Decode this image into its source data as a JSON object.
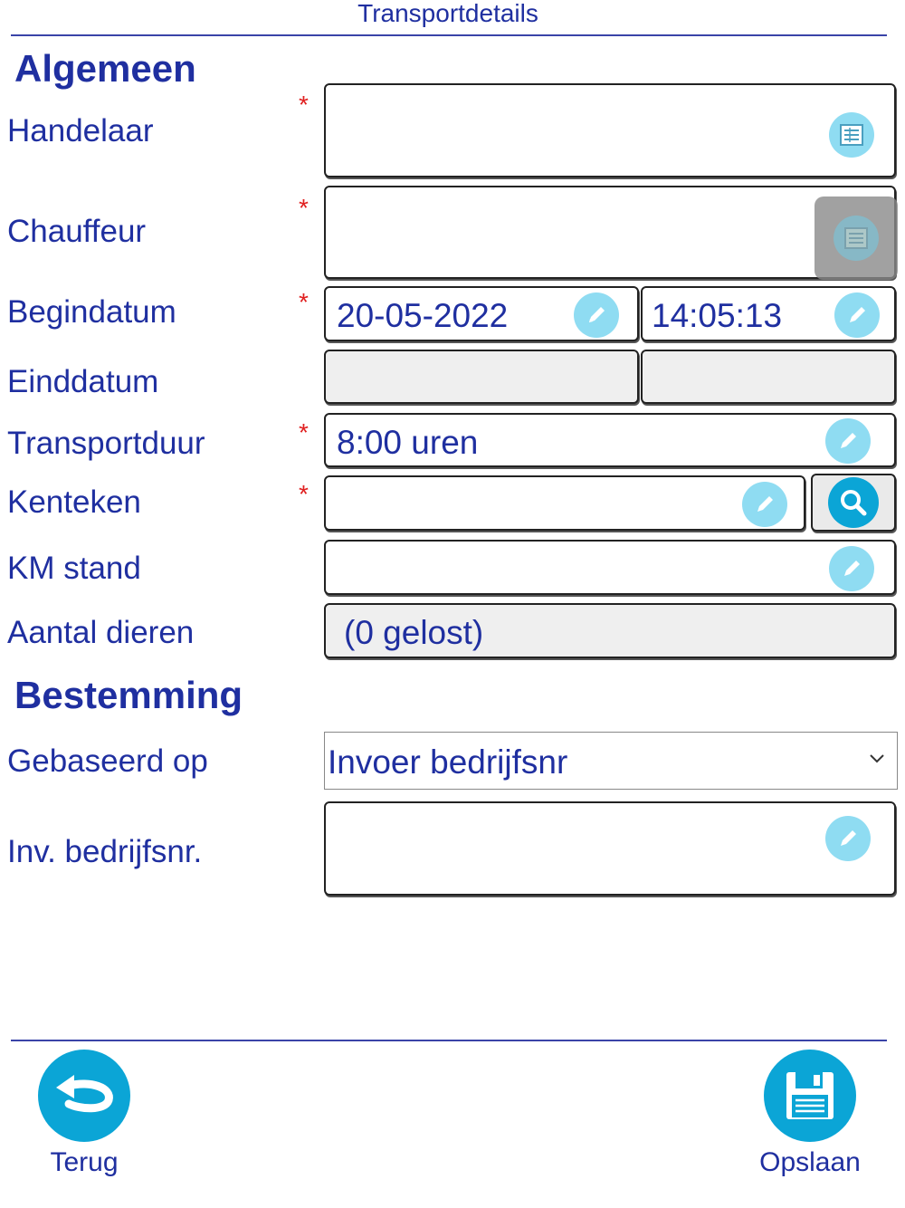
{
  "header": {
    "title": "Transportdetails"
  },
  "sections": {
    "general": "Algemeen",
    "destination": "Bestemming"
  },
  "required_mark": "*",
  "fields": {
    "handelaar": {
      "label": "Handelaar",
      "value": ""
    },
    "chauffeur": {
      "label": "Chauffeur",
      "value": ""
    },
    "begindatum": {
      "label": "Begindatum",
      "date": "20-05-2022",
      "time": "14:05:13"
    },
    "einddatum": {
      "label": "Einddatum",
      "date": "",
      "time": ""
    },
    "transportduur": {
      "label": "Transportduur",
      "value": "8:00 uren"
    },
    "kenteken": {
      "label": "Kenteken",
      "value": ""
    },
    "km_stand": {
      "label": "KM stand",
      "value": ""
    },
    "aantal_dieren": {
      "label": "Aantal dieren",
      "value": "(0 gelost)"
    },
    "gebaseerd_op": {
      "label": "Gebaseerd op",
      "selected": "Invoer bedrijfsnr"
    },
    "inv_bedrijfsnr": {
      "label": "Inv. bedrijfsnr.",
      "value": ""
    }
  },
  "footer": {
    "back_label": "Terug",
    "save_label": "Opslaan"
  },
  "icons": {
    "list": "list-icon",
    "edit": "pencil-icon",
    "search": "search-icon",
    "back": "back-arrow-icon",
    "save": "floppy-disk-icon",
    "chevron": "chevron-down-icon"
  },
  "colors": {
    "text": "#1f2fa0",
    "accent": "#0ba5d6",
    "icon_light": "#8fdcf2",
    "required": "#e02020"
  }
}
